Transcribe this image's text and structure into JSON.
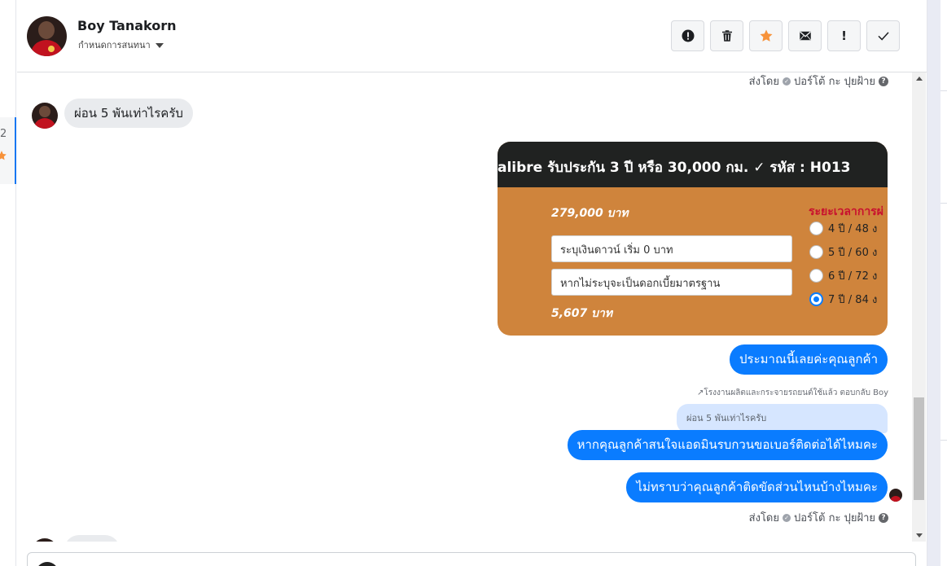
{
  "contact": {
    "name": "Boy Tanakorn",
    "assign_label": "กำหนดการสนทนา"
  },
  "toolbar": {
    "buttons": [
      {
        "name": "report-spam-button",
        "icon": "alert-circle-icon"
      },
      {
        "name": "delete-button",
        "icon": "trash-icon"
      },
      {
        "name": "star-button",
        "icon": "star-icon",
        "color": "#f7923a"
      },
      {
        "name": "mark-unread-button",
        "icon": "envelope-icon"
      },
      {
        "name": "follow-up-button",
        "icon": "exclamation-icon",
        "text": "!"
      },
      {
        "name": "mark-done-button",
        "icon": "check-icon"
      }
    ]
  },
  "left_list": {
    "count": "2"
  },
  "messages": {
    "sent_by_top": {
      "prefix": "ส่งโดย",
      "agent": "ปอร์โต้ กะ ปุยฝ้าย",
      "help": "?"
    },
    "incoming_1": "ผ่อน 5 พันเท่าไรครับ",
    "image_card": {
      "title": "alibre รับประกัน 3 ปี หรือ 30,000 กม. ✓ รหัส : H013",
      "price": "279,000 บาท",
      "down_payment_placeholder": "ระบุเงินดาวน์ เริ่ม 0 บาท",
      "interest_placeholder": "หากไม่ระบุจะเป็นดอกเบี้ยมาตรฐาน",
      "monthly": "5,607 บาท",
      "term_heading": "ระยะเวลาการผ่",
      "terms": [
        "4 ปี / 48 ง",
        "5 ปี / 60 ง",
        "6 ปี / 72 ง",
        "7 ปี / 84 ง"
      ],
      "selected_term_index": 3
    },
    "outgoing_1": "ประมาณนี้เลยค่ะคุณลูกค้า",
    "reply_note": "โรงงานผลิตและกระจายรถยนต์ใช้แล้ว ตอบกลับ Boy",
    "quoted_text": "ผ่อน 5 พันเท่าไรครับ",
    "outgoing_2": "หากคุณลูกค้าสนใจแอดมินรบกวนขอเบอร์ติดต่อได้ไหมคะ",
    "outgoing_3": "ไม่ทราบว่าคุณลูกค้าติดขัดส่วนไหนบ้างไหมคะ",
    "sent_by_bottom": {
      "prefix": "ส่งโดย",
      "agent": "ปอร์โต้ กะ ปุยฝ้าย",
      "help": "?"
    }
  },
  "colors": {
    "accent": "#0a7cff",
    "incoming_bubble": "#e9ebee",
    "card_orange": "#cf843c",
    "card_dark": "#202221"
  }
}
